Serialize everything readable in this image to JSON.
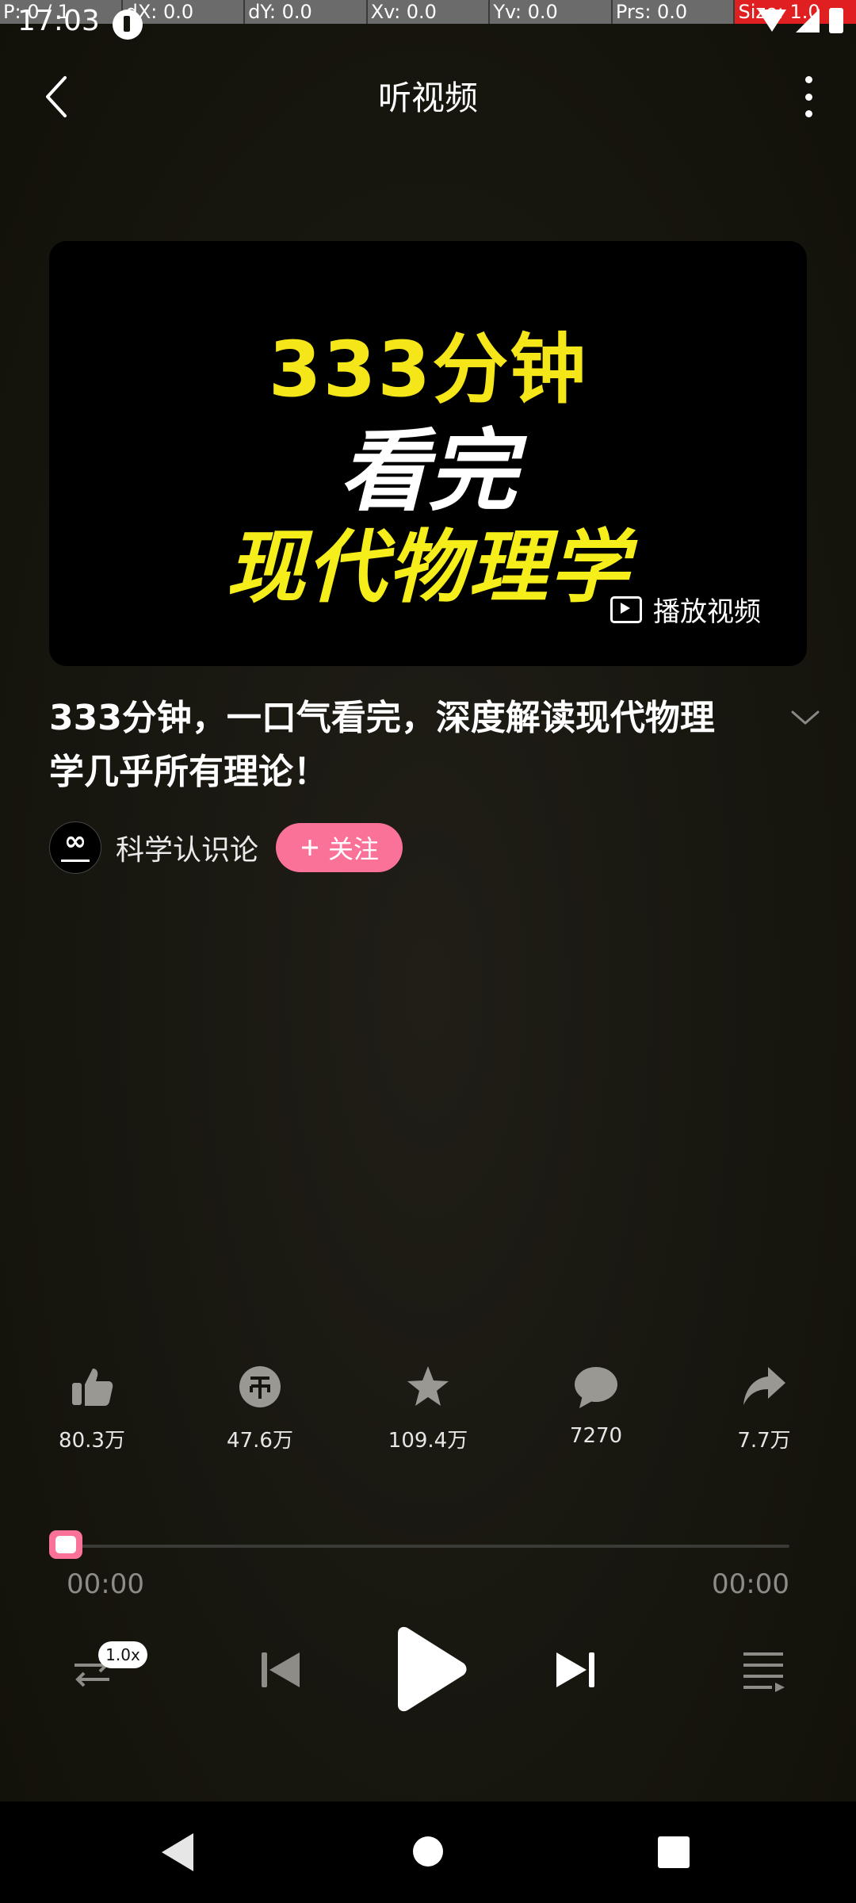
{
  "debug": {
    "p": "P: 0 / 1",
    "dx": "dX: 0.0",
    "dy": "dY: 0.0",
    "xv": "Xv: 0.0",
    "yv": "Yv: 0.0",
    "prs": "Prs: 0.0",
    "size": "Size: 1.0"
  },
  "status": {
    "time": "17:03"
  },
  "header": {
    "title": "听视频"
  },
  "cover": {
    "line1": "333分钟",
    "line2": "看完",
    "line3": "现代物理学",
    "play_video_label": "播放视频"
  },
  "video": {
    "title": "333分钟，一口气看完，深度解读现代物理学几乎所有理论！"
  },
  "author": {
    "name": "科学认识论",
    "follow_label": "关注",
    "follow_icon": "plus-icon"
  },
  "actions": [
    {
      "icon": "like-icon",
      "count": "80.3万"
    },
    {
      "icon": "coin-icon",
      "count": "47.6万"
    },
    {
      "icon": "star-icon",
      "count": "109.4万"
    },
    {
      "icon": "comment-icon",
      "count": "7270"
    },
    {
      "icon": "share-icon",
      "count": "7.7万"
    }
  ],
  "player": {
    "current_time": "00:00",
    "total_time": "00:00",
    "speed": "1.0x",
    "progress": 0
  },
  "colors": {
    "accent": "#fb7299",
    "cover_yellow": "#f5e61a",
    "background": "#15140f"
  }
}
